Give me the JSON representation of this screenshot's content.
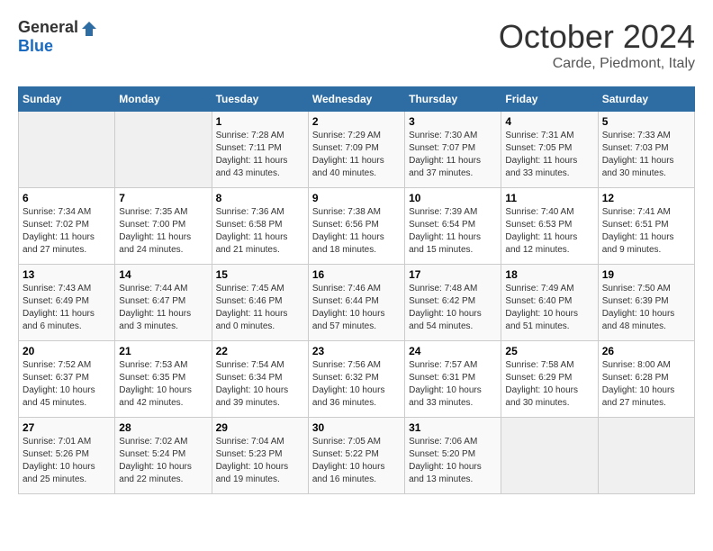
{
  "logo": {
    "general": "General",
    "blue": "Blue"
  },
  "title": "October 2024",
  "location": "Carde, Piedmont, Italy",
  "days_of_week": [
    "Sunday",
    "Monday",
    "Tuesday",
    "Wednesday",
    "Thursday",
    "Friday",
    "Saturday"
  ],
  "weeks": [
    [
      {
        "day": "",
        "info": ""
      },
      {
        "day": "",
        "info": ""
      },
      {
        "day": "1",
        "sunrise": "Sunrise: 7:28 AM",
        "sunset": "Sunset: 7:11 PM",
        "daylight": "Daylight: 11 hours and 43 minutes."
      },
      {
        "day": "2",
        "sunrise": "Sunrise: 7:29 AM",
        "sunset": "Sunset: 7:09 PM",
        "daylight": "Daylight: 11 hours and 40 minutes."
      },
      {
        "day": "3",
        "sunrise": "Sunrise: 7:30 AM",
        "sunset": "Sunset: 7:07 PM",
        "daylight": "Daylight: 11 hours and 37 minutes."
      },
      {
        "day": "4",
        "sunrise": "Sunrise: 7:31 AM",
        "sunset": "Sunset: 7:05 PM",
        "daylight": "Daylight: 11 hours and 33 minutes."
      },
      {
        "day": "5",
        "sunrise": "Sunrise: 7:33 AM",
        "sunset": "Sunset: 7:03 PM",
        "daylight": "Daylight: 11 hours and 30 minutes."
      }
    ],
    [
      {
        "day": "6",
        "sunrise": "Sunrise: 7:34 AM",
        "sunset": "Sunset: 7:02 PM",
        "daylight": "Daylight: 11 hours and 27 minutes."
      },
      {
        "day": "7",
        "sunrise": "Sunrise: 7:35 AM",
        "sunset": "Sunset: 7:00 PM",
        "daylight": "Daylight: 11 hours and 24 minutes."
      },
      {
        "day": "8",
        "sunrise": "Sunrise: 7:36 AM",
        "sunset": "Sunset: 6:58 PM",
        "daylight": "Daylight: 11 hours and 21 minutes."
      },
      {
        "day": "9",
        "sunrise": "Sunrise: 7:38 AM",
        "sunset": "Sunset: 6:56 PM",
        "daylight": "Daylight: 11 hours and 18 minutes."
      },
      {
        "day": "10",
        "sunrise": "Sunrise: 7:39 AM",
        "sunset": "Sunset: 6:54 PM",
        "daylight": "Daylight: 11 hours and 15 minutes."
      },
      {
        "day": "11",
        "sunrise": "Sunrise: 7:40 AM",
        "sunset": "Sunset: 6:53 PM",
        "daylight": "Daylight: 11 hours and 12 minutes."
      },
      {
        "day": "12",
        "sunrise": "Sunrise: 7:41 AM",
        "sunset": "Sunset: 6:51 PM",
        "daylight": "Daylight: 11 hours and 9 minutes."
      }
    ],
    [
      {
        "day": "13",
        "sunrise": "Sunrise: 7:43 AM",
        "sunset": "Sunset: 6:49 PM",
        "daylight": "Daylight: 11 hours and 6 minutes."
      },
      {
        "day": "14",
        "sunrise": "Sunrise: 7:44 AM",
        "sunset": "Sunset: 6:47 PM",
        "daylight": "Daylight: 11 hours and 3 minutes."
      },
      {
        "day": "15",
        "sunrise": "Sunrise: 7:45 AM",
        "sunset": "Sunset: 6:46 PM",
        "daylight": "Daylight: 11 hours and 0 minutes."
      },
      {
        "day": "16",
        "sunrise": "Sunrise: 7:46 AM",
        "sunset": "Sunset: 6:44 PM",
        "daylight": "Daylight: 10 hours and 57 minutes."
      },
      {
        "day": "17",
        "sunrise": "Sunrise: 7:48 AM",
        "sunset": "Sunset: 6:42 PM",
        "daylight": "Daylight: 10 hours and 54 minutes."
      },
      {
        "day": "18",
        "sunrise": "Sunrise: 7:49 AM",
        "sunset": "Sunset: 6:40 PM",
        "daylight": "Daylight: 10 hours and 51 minutes."
      },
      {
        "day": "19",
        "sunrise": "Sunrise: 7:50 AM",
        "sunset": "Sunset: 6:39 PM",
        "daylight": "Daylight: 10 hours and 48 minutes."
      }
    ],
    [
      {
        "day": "20",
        "sunrise": "Sunrise: 7:52 AM",
        "sunset": "Sunset: 6:37 PM",
        "daylight": "Daylight: 10 hours and 45 minutes."
      },
      {
        "day": "21",
        "sunrise": "Sunrise: 7:53 AM",
        "sunset": "Sunset: 6:35 PM",
        "daylight": "Daylight: 10 hours and 42 minutes."
      },
      {
        "day": "22",
        "sunrise": "Sunrise: 7:54 AM",
        "sunset": "Sunset: 6:34 PM",
        "daylight": "Daylight: 10 hours and 39 minutes."
      },
      {
        "day": "23",
        "sunrise": "Sunrise: 7:56 AM",
        "sunset": "Sunset: 6:32 PM",
        "daylight": "Daylight: 10 hours and 36 minutes."
      },
      {
        "day": "24",
        "sunrise": "Sunrise: 7:57 AM",
        "sunset": "Sunset: 6:31 PM",
        "daylight": "Daylight: 10 hours and 33 minutes."
      },
      {
        "day": "25",
        "sunrise": "Sunrise: 7:58 AM",
        "sunset": "Sunset: 6:29 PM",
        "daylight": "Daylight: 10 hours and 30 minutes."
      },
      {
        "day": "26",
        "sunrise": "Sunrise: 8:00 AM",
        "sunset": "Sunset: 6:28 PM",
        "daylight": "Daylight: 10 hours and 27 minutes."
      }
    ],
    [
      {
        "day": "27",
        "sunrise": "Sunrise: 7:01 AM",
        "sunset": "Sunset: 5:26 PM",
        "daylight": "Daylight: 10 hours and 25 minutes."
      },
      {
        "day": "28",
        "sunrise": "Sunrise: 7:02 AM",
        "sunset": "Sunset: 5:24 PM",
        "daylight": "Daylight: 10 hours and 22 minutes."
      },
      {
        "day": "29",
        "sunrise": "Sunrise: 7:04 AM",
        "sunset": "Sunset: 5:23 PM",
        "daylight": "Daylight: 10 hours and 19 minutes."
      },
      {
        "day": "30",
        "sunrise": "Sunrise: 7:05 AM",
        "sunset": "Sunset: 5:22 PM",
        "daylight": "Daylight: 10 hours and 16 minutes."
      },
      {
        "day": "31",
        "sunrise": "Sunrise: 7:06 AM",
        "sunset": "Sunset: 5:20 PM",
        "daylight": "Daylight: 10 hours and 13 minutes."
      },
      {
        "day": "",
        "info": ""
      },
      {
        "day": "",
        "info": ""
      }
    ]
  ]
}
